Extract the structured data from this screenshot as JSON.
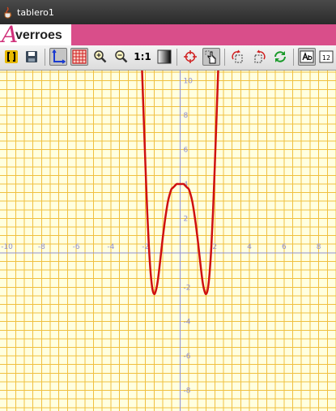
{
  "window": {
    "title": "tablero1"
  },
  "banner": {
    "logo_initial": "A",
    "logo_rest": "verroes"
  },
  "toolbar": {
    "one_to_one_label": "1:1",
    "grid_toggle_on": true,
    "axes_toggle_on": true,
    "pointer_tool_on": true,
    "numeric_icon_label": "12"
  },
  "colors": {
    "grid": "#f0c040",
    "axes": "#8f8fd4",
    "curve": "#d01010",
    "background": "#ffffe0",
    "banner": "#d94e8a"
  },
  "chart_data": {
    "type": "line",
    "title": "",
    "xlabel": "",
    "ylabel": "",
    "xlim": [
      -10.4,
      9.0
    ],
    "ylim": [
      -9.2,
      10.6
    ],
    "grid": true,
    "x_ticks": [
      -10,
      -8,
      -6,
      -4,
      -2,
      2,
      4,
      6,
      8
    ],
    "x_tick_labels": [
      "-10",
      "-8",
      "-6",
      "-4",
      "-2",
      "2",
      "4",
      "6",
      "8"
    ],
    "y_ticks": [
      10,
      8,
      6,
      4,
      2,
      -2,
      -4,
      -6,
      -8
    ],
    "y_tick_labels": [
      "10",
      "8",
      "6",
      "4",
      "2",
      "-2",
      "-4",
      "-6",
      "-8"
    ],
    "series": [
      {
        "color": "#d01010",
        "x": [
          -2.2,
          -2.1,
          -2.0,
          -1.9,
          -1.8,
          -1.7,
          -1.6,
          -1.5,
          -1.4,
          -1.3,
          -1.2,
          -1.1,
          -1.0,
          -0.9,
          -0.8,
          -0.7,
          -0.6,
          -0.5,
          -0.4,
          -0.3,
          -0.2,
          -0.1,
          0.0,
          0.1,
          0.2,
          0.3,
          0.4,
          0.5,
          0.6,
          0.7,
          0.8,
          0.9,
          1.0,
          1.1,
          1.2,
          1.3,
          1.4,
          1.5,
          1.6,
          1.7,
          1.8,
          1.9,
          2.0,
          2.1,
          2.2
        ],
        "y": [
          10.7,
          7.8,
          5.0,
          2.4,
          0.3,
          -1.2,
          -2.1,
          -2.4,
          -2.2,
          -1.7,
          -0.9,
          0.0,
          0.9,
          1.7,
          2.4,
          3.0,
          3.4,
          3.7,
          3.8,
          3.9,
          4.0,
          4.0,
          4.0,
          4.0,
          4.0,
          3.9,
          3.8,
          3.7,
          3.4,
          3.0,
          2.4,
          1.7,
          0.9,
          0.0,
          -0.9,
          -1.7,
          -2.2,
          -2.4,
          -2.1,
          -1.2,
          0.3,
          2.4,
          5.0,
          7.8,
          10.7
        ]
      }
    ]
  }
}
